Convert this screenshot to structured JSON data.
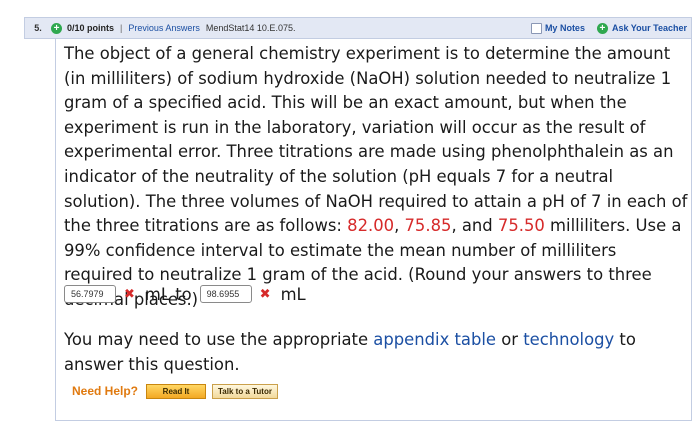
{
  "header": {
    "question_number": "5.",
    "points": "0/10 points",
    "separator": "|",
    "previous_answers": "Previous Answers",
    "problem_id": "MendStat14 10.E.075.",
    "my_notes": "My Notes",
    "ask_teacher": "Ask Your Teacher",
    "icons": [
      "plus-circle-icon",
      "notes-checkbox-icon",
      "plus-circle-icon"
    ],
    "colors": {
      "bar_bg": "#e3e8f4",
      "link": "#1b4fa3",
      "green": "#2fa84f",
      "red": "#d62a2a"
    }
  },
  "question": {
    "text_before": "The object of a general chemistry experiment is to determine the amount (in milliliters) of sodium hydroxide (NaOH) solution needed to neutralize 1 gram of a specified acid. This will be an exact amount, but when the experiment is run in the laboratory, variation will occur as the result of experimental error. Three titrations are made using phenolphthalein as an indicator of the neutrality of the solution (pH equals 7 for a neutral solution). The three volumes of NaOH required to attain a pH of 7 in each of the three titrations are as follows: ",
    "values": [
      "82.00",
      "75.85",
      "75.50"
    ],
    "comma1": ", ",
    "comma2": ", and ",
    "text_after": " milliliters. Use a 99% confidence interval to estimate the mean number of milliliters required to neutralize 1 gram of the acid. (Round your answers to three decimal places.)"
  },
  "answer": {
    "lower_value": "56.7979",
    "lower_unit": "mL to",
    "upper_value": "98.6955",
    "upper_unit": "mL",
    "incorrect_mark": "✖"
  },
  "note": {
    "text_before": "You may need to use the appropriate ",
    "appendix_link": "appendix table",
    "or": " or ",
    "technology_link": "technology",
    "text_after": " to answer this question."
  },
  "help": {
    "need_help": "Need Help?",
    "read_it": "Read It",
    "talk_to_tutor": "Talk to a Tutor"
  }
}
